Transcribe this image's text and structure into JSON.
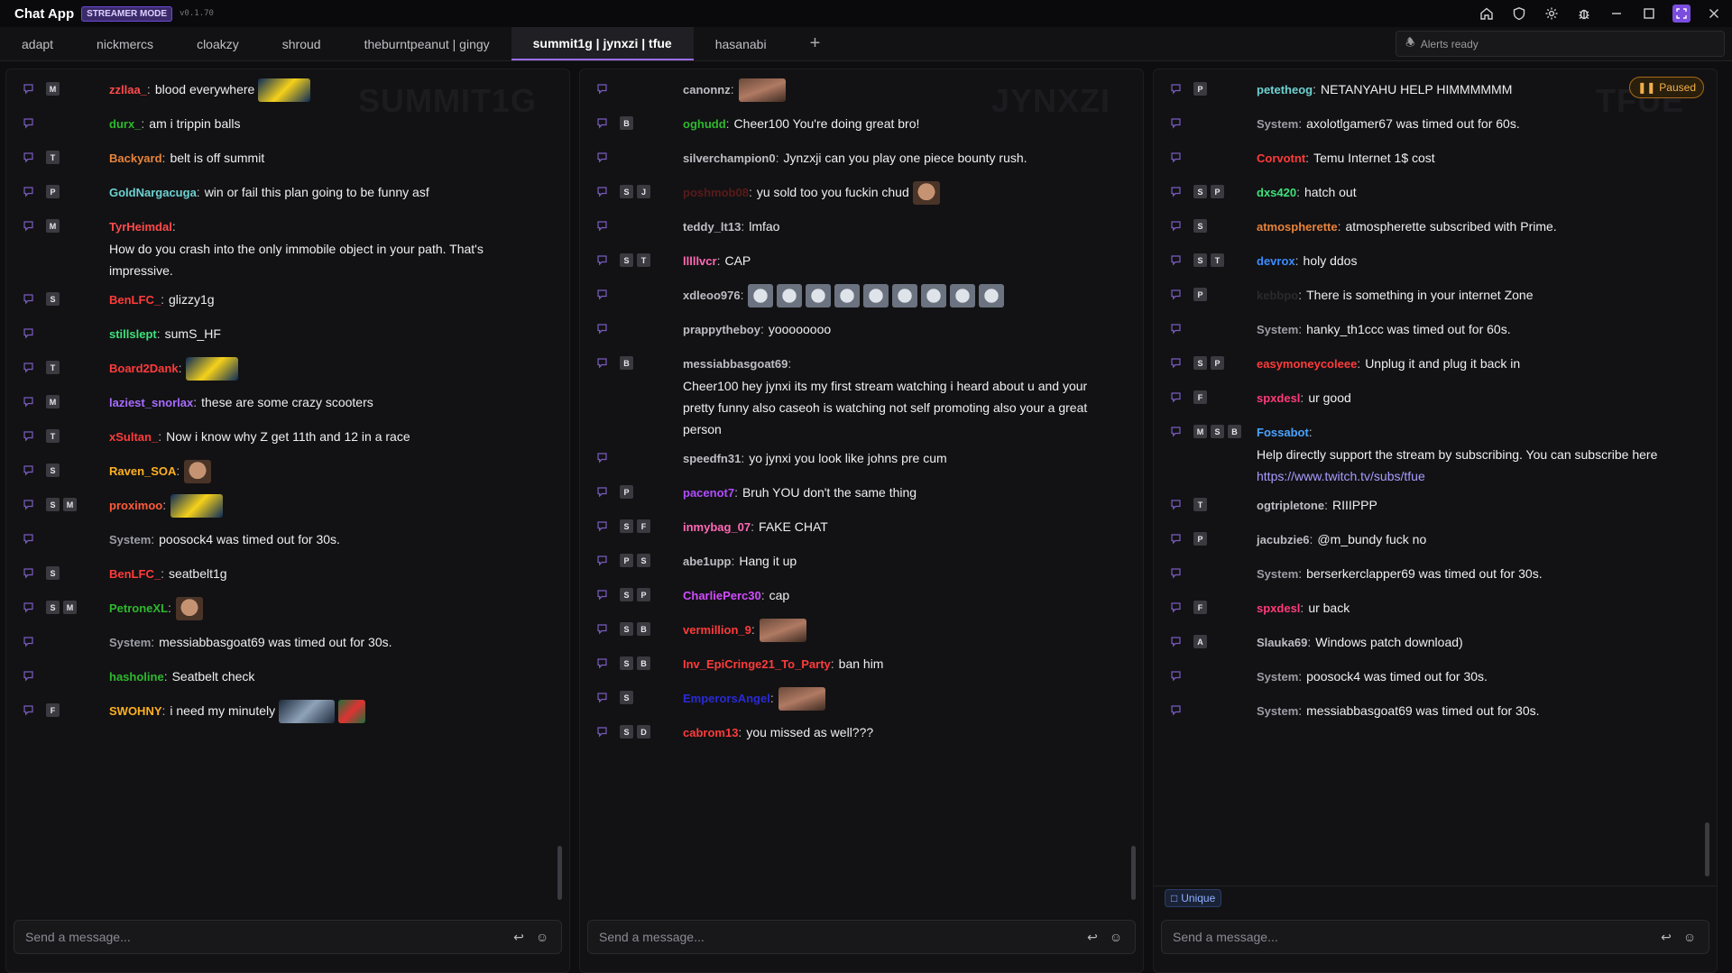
{
  "app": {
    "title": "Chat App",
    "mode_badge": "STREAMER MODE",
    "version": "v0.1.70"
  },
  "tabs": [
    {
      "label": "adapt",
      "active": false
    },
    {
      "label": "nickmercs",
      "active": false
    },
    {
      "label": "cloakzy",
      "active": false
    },
    {
      "label": "shroud",
      "active": false
    },
    {
      "label": "theburntpeanut | gingy",
      "active": false
    },
    {
      "label": "summit1g | jynxzi | tfue",
      "active": true
    },
    {
      "label": "hasanabi",
      "active": false
    }
  ],
  "tab_add": "+",
  "alerts": {
    "text": "Alerts ready"
  },
  "panels": [
    {
      "watermark": "SUMMIT1G",
      "input_placeholder": "Send a message...",
      "messages": [
        {
          "badges": [
            "M"
          ],
          "user": "zzllaa_",
          "color": "#ff4b4b",
          "text": "blood everywhere",
          "emotes": [
            "e1"
          ]
        },
        {
          "badges": [],
          "user": "durx_",
          "color": "#2eb82e",
          "text": "am i trippin balls"
        },
        {
          "badges": [
            "T"
          ],
          "user": "Backyard",
          "color": "#e8833a",
          "text": "belt is off summit"
        },
        {
          "badges": [
            "P"
          ],
          "user": "GoldNargacuga",
          "color": "#6ed1d1",
          "text": "win or fail this plan going to be funny asf"
        },
        {
          "badges": [
            "M"
          ],
          "user": "TyrHeimdal",
          "color": "#ff4b4b",
          "text": "",
          "long": "How do you crash into the only immobile object in your path. That's impressive."
        },
        {
          "badges": [
            "S"
          ],
          "user": "BenLFC_",
          "color": "#ff3b3b",
          "text": "glizzy1g"
        },
        {
          "badges": [],
          "user": "stillslept",
          "color": "#3fe07a",
          "text": "sumS_HF"
        },
        {
          "badges": [
            "T"
          ],
          "user": "Board2Dank",
          "color": "#ff3b3b",
          "text": "",
          "emotes": [
            "e1"
          ]
        },
        {
          "badges": [
            "M"
          ],
          "user": "laziest_snorlax",
          "color": "#a86bff",
          "text": "these are some crazy scooters"
        },
        {
          "badges": [
            "T"
          ],
          "user": "xSultan_",
          "color": "#ff3b3b",
          "text": "Now i know why Z get 11th and 12 in a race"
        },
        {
          "badges": [
            "S"
          ],
          "user": "Raven_SOA",
          "color": "#ffb020",
          "text": "",
          "emotes": [
            "face"
          ]
        },
        {
          "badges": [
            "S",
            "M"
          ],
          "user": "proximoo",
          "color": "#ff5b3b",
          "text": "",
          "emotes": [
            "e1"
          ]
        },
        {
          "badges": [],
          "user": "System",
          "color": "#9d9da6",
          "text": "poosock4 was timed out for 30s.",
          "system": true
        },
        {
          "badges": [
            "S"
          ],
          "user": "BenLFC_",
          "color": "#ff3b3b",
          "text": "seatbelt1g"
        },
        {
          "badges": [
            "S",
            "M"
          ],
          "user": "PetroneXL",
          "color": "#2eb82e",
          "text": "",
          "emotes": [
            "face"
          ]
        },
        {
          "badges": [],
          "user": "System",
          "color": "#9d9da6",
          "text": "messiabbasgoat69 was timed out for 30s.",
          "system": true
        },
        {
          "badges": [],
          "user": "hasholine",
          "color": "#2eb82e",
          "text": "Seatbelt check"
        },
        {
          "badges": [
            "F"
          ],
          "user": "SWOHNY",
          "color": "#ffb020",
          "text": "i need my minutely",
          "emotes": [
            "moto",
            "small"
          ]
        }
      ]
    },
    {
      "watermark": "JYNXZI",
      "input_placeholder": "Send a message...",
      "messages": [
        {
          "badges": [],
          "user": "canonnz",
          "color": "#bdbdc4",
          "text": "",
          "emotes": [
            "photo"
          ]
        },
        {
          "badges": [
            "B"
          ],
          "user": "oghudd",
          "color": "#2eb82e",
          "text": "Cheer100 You're doing great bro!"
        },
        {
          "badges": [],
          "user": "silverchampion0",
          "color": "#bdbdc4",
          "text": "Jynzxji can you play one piece bounty rush."
        },
        {
          "badges": [
            "S",
            "J"
          ],
          "user": "poshmob08",
          "color": "#5a1a1a",
          "text": "yu sold too you fuckin chud",
          "emotes": [
            "face"
          ]
        },
        {
          "badges": [],
          "user": "teddy_lt13",
          "color": "#bdbdc4",
          "text": "lmfao"
        },
        {
          "badges": [
            "S",
            "T"
          ],
          "user": "lllllvcr",
          "color": "#ff69b4",
          "text": "CAP"
        },
        {
          "badges": [],
          "user": "xdleoo976",
          "color": "#bdbdc4",
          "text": "",
          "emotes": [
            "crying",
            "crying",
            "crying",
            "crying",
            "crying",
            "crying",
            "crying",
            "crying",
            "crying"
          ]
        },
        {
          "badges": [],
          "user": "prappytheboy",
          "color": "#bdbdc4",
          "text": "yoooooooo"
        },
        {
          "badges": [
            "B"
          ],
          "user": "messiabbasgoat69",
          "color": "#bdbdc4",
          "text": "",
          "long": "Cheer100 hey jynxi its my first stream watching i heard about u and your pretty funny also caseoh is watching not self promoting also your a great person"
        },
        {
          "badges": [],
          "user": "speedfn31",
          "color": "#bdbdc4",
          "text": "yo jynxi you look like johns pre cum"
        },
        {
          "badges": [
            "P"
          ],
          "user": "pacenot7",
          "color": "#b04cff",
          "text": "Bruh YOU don't the same thing"
        },
        {
          "badges": [
            "S",
            "F"
          ],
          "user": "inmybag_07",
          "color": "#ff69b4",
          "text": "FAKE CHAT"
        },
        {
          "badges": [
            "P",
            "S"
          ],
          "user": "abe1upp",
          "color": "#bdbdc4",
          "text": "Hang it up"
        },
        {
          "badges": [
            "S",
            "P"
          ],
          "user": "CharliePerc30",
          "color": "#d14cff",
          "text": "cap"
        },
        {
          "badges": [
            "S",
            "B"
          ],
          "user": "vermillion_9",
          "color": "#ff3b3b",
          "text": "",
          "emotes": [
            "photo"
          ]
        },
        {
          "badges": [
            "S",
            "B"
          ],
          "user": "Inv_EpiCringe21_To_Party",
          "color": "#ff3b3b",
          "text": "ban him"
        },
        {
          "badges": [
            "S"
          ],
          "user": "EmperorsAngel",
          "color": "#2a2ad6",
          "text": "",
          "emotes": [
            "photo"
          ]
        },
        {
          "badges": [
            "S",
            "D"
          ],
          "user": "cabrom13",
          "color": "#ff3b3b",
          "text": "you missed as well???"
        }
      ]
    },
    {
      "watermark": "TFUE",
      "paused_label": "Paused",
      "unique_label": "Unique",
      "input_placeholder": "Send a message...",
      "messages": [
        {
          "badges": [
            "P"
          ],
          "user": "petetheog",
          "color": "#6ed1d1",
          "text": "NETANYAHU HELP HIMMMMMM"
        },
        {
          "badges": [],
          "user": "System",
          "color": "#9d9da6",
          "text": "axolotlgamer67 was timed out for 60s.",
          "system": true
        },
        {
          "badges": [],
          "user": "Corvotnt",
          "color": "#ff3b3b",
          "text": "Temu Internet 1$ cost"
        },
        {
          "badges": [
            "S",
            "P"
          ],
          "user": "dxs420",
          "color": "#3fe07a",
          "text": "hatch out"
        },
        {
          "badges": [
            "S"
          ],
          "user": "atmospherette",
          "color": "#e8833a",
          "text": "atmospherette subscribed with Prime."
        },
        {
          "badges": [
            "S",
            "T"
          ],
          "user": "devrox",
          "color": "#3c8cff",
          "text": "holy ddos"
        },
        {
          "badges": [
            "P"
          ],
          "user": "kebbpo",
          "color": "#2a2a2e",
          "text": "There is something in your internet Zone"
        },
        {
          "badges": [],
          "user": "System",
          "color": "#9d9da6",
          "text": "hanky_th1ccc was timed out for 60s.",
          "system": true
        },
        {
          "badges": [
            "S",
            "P"
          ],
          "user": "easymoneycoleee",
          "color": "#ff3b3b",
          "text": "Unplug it and plug it back in"
        },
        {
          "badges": [
            "F"
          ],
          "user": "spxdesl",
          "color": "#ff3b7a",
          "text": "ur good"
        },
        {
          "badges": [
            "M",
            "S",
            "B"
          ],
          "user": "Fossabot",
          "color": "#4ba3ff",
          "text": "",
          "long": "Help directly support the stream by subscribing. You can subscribe here",
          "link": "https://www.twitch.tv/subs/tfue"
        },
        {
          "badges": [
            "T"
          ],
          "user": "ogtripletone",
          "color": "#bdbdc4",
          "text": "RIIIPPP"
        },
        {
          "badges": [
            "P"
          ],
          "user": "jacubzie6",
          "color": "#bdbdc4",
          "text": "@m_bundy fuck no"
        },
        {
          "badges": [],
          "user": "System",
          "color": "#9d9da6",
          "text": "berserkerclapper69 was timed out for 30s.",
          "system": true
        },
        {
          "badges": [
            "F"
          ],
          "user": "spxdesl",
          "color": "#ff3b7a",
          "text": "ur back"
        },
        {
          "badges": [
            "A"
          ],
          "user": "Slauka69",
          "color": "#bdbdc4",
          "text": "Windows patch download)"
        },
        {
          "badges": [],
          "user": "System",
          "color": "#9d9da6",
          "text": "poosock4 was timed out for 30s.",
          "system": true
        },
        {
          "badges": [],
          "user": "System",
          "color": "#9d9da6",
          "text": "messiabbasgoat69 was timed out for 30s.",
          "system": true
        }
      ]
    }
  ],
  "colors": {
    "accent": "#9b6df5",
    "paused": "#f1b04c"
  }
}
